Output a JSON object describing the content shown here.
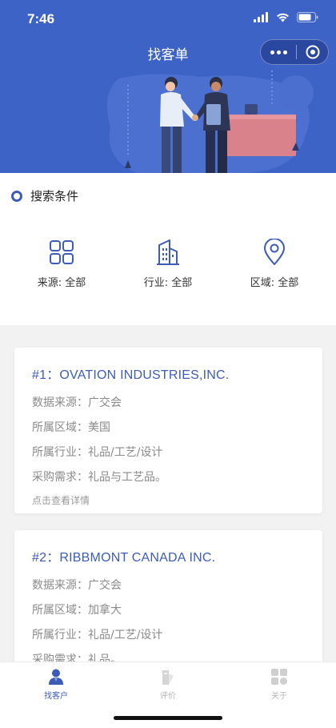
{
  "status_bar": {
    "time": "7:46"
  },
  "nav": {
    "title": "找客单"
  },
  "icons": {
    "more": "more-dots-icon",
    "close": "capsule-close-icon",
    "search_condition": "ring-icon",
    "source": "grid-icon",
    "industry": "building-icon",
    "region": "location-pin-icon"
  },
  "colors": {
    "brand": "#3d63c7",
    "accent": "#3d5cb8",
    "muted": "#8a8a8a"
  },
  "search": {
    "title": "搜索条件",
    "filters": [
      {
        "label": "来源: 全部"
      },
      {
        "label": "行业: 全部"
      },
      {
        "label": "区域: 全部"
      }
    ]
  },
  "cards": [
    {
      "title": "#1：OVATION INDUSTRIES,INC.",
      "source": "数据来源：广交会",
      "region": "所属区域：美国",
      "industry": "所属行业：礼品/工艺/设计",
      "demand": "采购需求：礼品与工艺品。",
      "link": "点击查看详情"
    },
    {
      "title": "#2：RIBBMONT CANADA INC.",
      "source": "数据来源：广交会",
      "region": "所属区域：加拿大",
      "industry": "所属行业：礼品/工艺/设计",
      "demand": "采购需求：礼品。"
    }
  ],
  "tabbar": {
    "tabs": [
      {
        "label": "找客户",
        "icon": "user-icon",
        "active": true
      },
      {
        "label": "评价",
        "icon": "review-icon",
        "active": false
      },
      {
        "label": "关于",
        "icon": "apps-icon",
        "active": false
      }
    ]
  }
}
